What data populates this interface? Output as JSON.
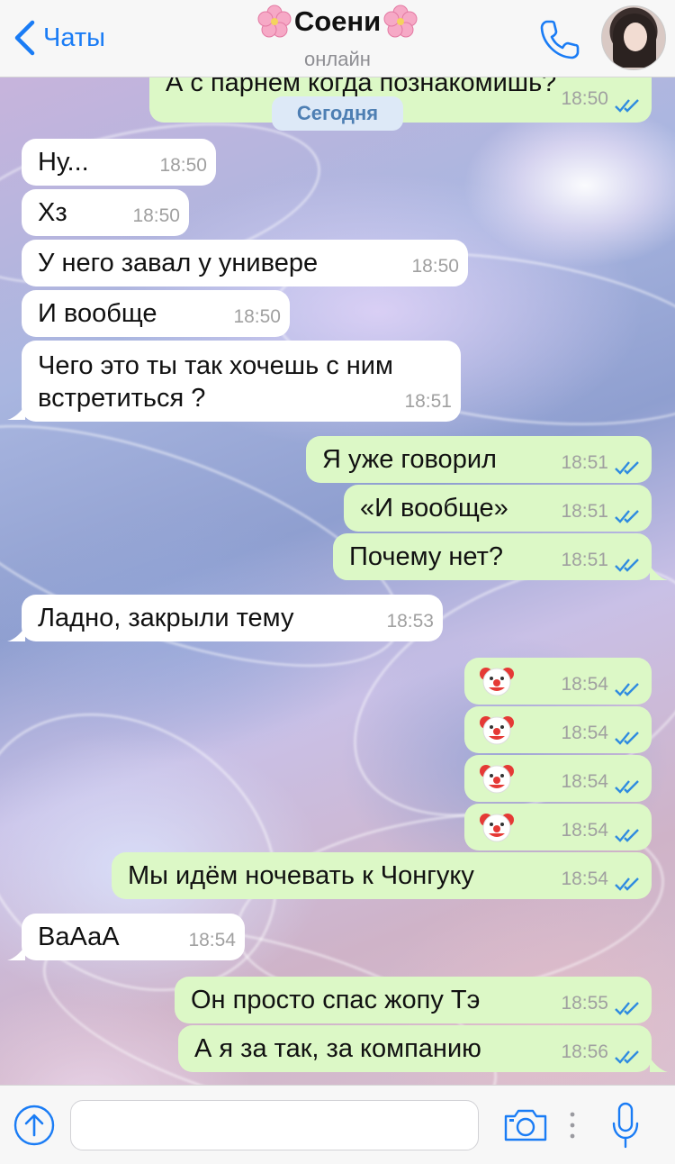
{
  "header": {
    "back_label": "Чаты",
    "contact_name": "Соени",
    "status": "онлайн",
    "accent_color": "#1a7cf5"
  },
  "date_separator": "Сегодня",
  "partial_top_message": {
    "text": "А с парнем когда познакомишь?",
    "time": "18:50"
  },
  "messages": [
    {
      "dir": "in",
      "text": "Ну...",
      "time": "18:50"
    },
    {
      "dir": "in",
      "text": "Хз",
      "time": "18:50"
    },
    {
      "dir": "in",
      "text": "У него завал у универе",
      "time": "18:50"
    },
    {
      "dir": "in",
      "text": "И вообще",
      "time": "18:50"
    },
    {
      "dir": "in",
      "text_line1": "Чего это ты так хочешь с ним",
      "text_line2": "встретиться ?",
      "time": "18:51"
    },
    {
      "dir": "out",
      "text": "Я уже говорил",
      "time": "18:51"
    },
    {
      "dir": "out",
      "text": "«И вообще»",
      "time": "18:51"
    },
    {
      "dir": "out",
      "text": "Почему нет?",
      "time": "18:51"
    },
    {
      "dir": "in",
      "text": "Ладно, закрыли тему",
      "time": "18:53"
    },
    {
      "dir": "out",
      "emoji": "clown-face",
      "time": "18:54"
    },
    {
      "dir": "out",
      "emoji": "clown-face",
      "time": "18:54"
    },
    {
      "dir": "out",
      "emoji": "clown-face",
      "time": "18:54"
    },
    {
      "dir": "out",
      "emoji": "clown-face",
      "time": "18:54"
    },
    {
      "dir": "out",
      "text": "Мы идём ночевать к Чонгуку",
      "time": "18:54"
    },
    {
      "dir": "in",
      "text": "ВаАаА",
      "time": "18:54"
    },
    {
      "dir": "out",
      "text": "Он просто спас жопу Тэ",
      "time": "18:55"
    },
    {
      "dir": "out",
      "text": "А я за так, за компанию",
      "time": "18:56"
    }
  ],
  "input": {
    "placeholder": "",
    "value": ""
  },
  "colors": {
    "incoming_bubble": "#ffffff",
    "outgoing_bubble": "#dcf8c6",
    "read_ticks": "#2f8be0"
  }
}
